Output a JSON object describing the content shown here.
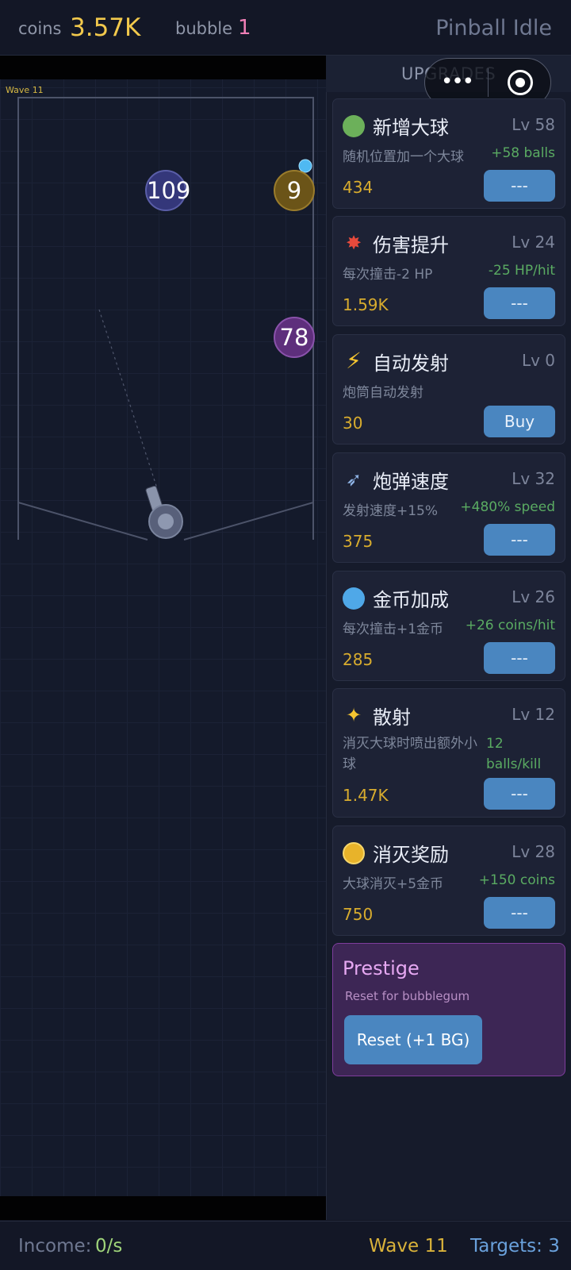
{
  "header": {
    "coins_label": "coins",
    "coins_value": "3.57K",
    "bubble_label": "bubble",
    "bubble_value": "1",
    "title": "Pinball Idle"
  },
  "game": {
    "wave_tag": "Wave 11",
    "bubbles": [
      {
        "hp": "109",
        "color": "#34377a"
      },
      {
        "hp": "9",
        "color": "#6b5418"
      },
      {
        "hp": "78",
        "color": "#5e2f7c"
      }
    ]
  },
  "panel": {
    "title": "UPGRADES",
    "upgrades": [
      {
        "icon": "green-ball-icon",
        "name": "新增大球",
        "level": "Lv 58",
        "desc": "随机位置加一个大球",
        "gain": "+58 balls",
        "cost": "434",
        "button": "---"
      },
      {
        "icon": "collision-icon",
        "name": "伤害提升",
        "level": "Lv 24",
        "desc": "每次撞击-2 HP",
        "gain": "-25 HP/hit",
        "cost": "1.59K",
        "button": "---"
      },
      {
        "icon": "lightning-icon",
        "name": "自动发射",
        "level": "Lv 0",
        "desc": "炮筒自动发射",
        "gain": "",
        "cost": "30",
        "button": "Buy"
      },
      {
        "icon": "rocket-icon",
        "name": "炮弹速度",
        "level": "Lv 32",
        "desc": "发射速度+15%",
        "gain": "+480% speed",
        "cost": "375",
        "button": "---"
      },
      {
        "icon": "blue-coin-icon",
        "name": "金币加成",
        "level": "Lv 26",
        "desc": "每次撞击+1金币",
        "gain": "+26 coins/hit",
        "cost": "285",
        "button": "---"
      },
      {
        "icon": "shooting-star-icon",
        "name": "散射",
        "level": "Lv 12",
        "desc": "消灭大球时喷出额外小球",
        "gain": "12 balls/kill",
        "cost": "1.47K",
        "button": "---"
      },
      {
        "icon": "gold-coin-icon",
        "name": "消灭奖励",
        "level": "Lv 28",
        "desc": "大球消灭+5金币",
        "gain": "+150 coins",
        "cost": "750",
        "button": "---"
      }
    ],
    "prestige": {
      "title": "Prestige",
      "subtitle": "Reset for bubblegum",
      "button": "Reset (+1 BG)"
    }
  },
  "footer": {
    "income_label": "Income:",
    "income_value": "0/s",
    "wave": "Wave 11",
    "targets": "Targets: 3"
  },
  "colors": {
    "coins": "#f2c94c",
    "bubble": "#ef7fb6",
    "income": "#9fd47a",
    "wave": "#d9b23a",
    "targets": "#6aa1dc",
    "button": "#4a86c0"
  }
}
